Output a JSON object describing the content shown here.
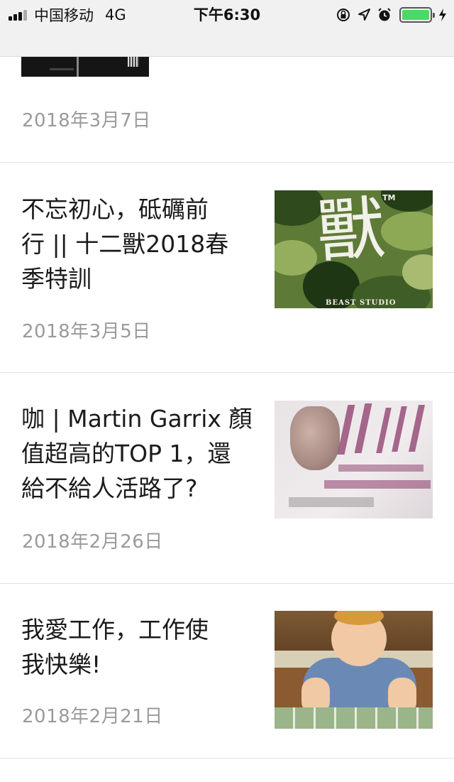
{
  "status_bar": {
    "carrier": "中国移动",
    "network": "4G",
    "time": "下午6:30",
    "battery_level": 1.0,
    "icons": [
      "rotation-lock-icon",
      "location-icon",
      "alarm-icon",
      "charging-icon"
    ]
  },
  "colors": {
    "date_text": "#9a9a9a",
    "title_text": "#1b1b1b",
    "battery_fill": "#4cd964",
    "status_bar_bg": "#f1f1f1"
  },
  "articles": [
    {
      "date": "2018年3月7日"
    },
    {
      "title": "不忘初心，砥礪前行 || 十二獸2018春季特訓",
      "title_lines": [
        "不忘初心，砥礪前",
        "行 || 十二獸2018春",
        "季特訓"
      ],
      "date": "2018年3月5日",
      "thumb": {
        "brand": "獸",
        "tm": "TM",
        "studio": "BEAST STUDIO"
      }
    },
    {
      "title": "咖 | Martin Garrix 顏值超高的TOP 1，還給不給人活路了?",
      "title_lines": [
        "咖 | Martin Garrix 顏",
        "值超高的TOP 1，還",
        "給不給人活路了?"
      ],
      "date": "2018年2月26日"
    },
    {
      "title": "我愛工作，工作使我快樂!",
      "title_lines": [
        "我愛工作，工作使",
        "我快樂!"
      ],
      "date": "2018年2月21日"
    }
  ]
}
